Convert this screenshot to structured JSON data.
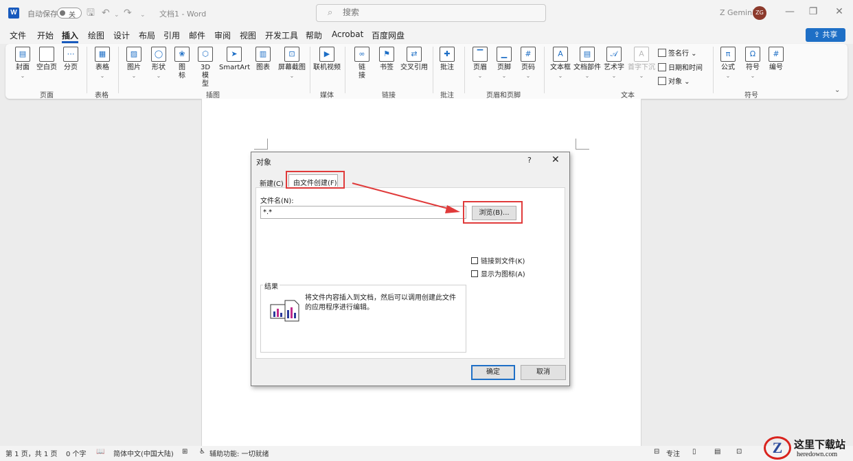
{
  "titlebar": {
    "autosave_label": "自动保存",
    "autosave_state": "关",
    "doc_title": "文档1  -  Word",
    "search_placeholder": "搜索",
    "user_name": "Z Gemini",
    "user_initials": "ZG"
  },
  "menu": {
    "tabs": [
      "文件",
      "开始",
      "插入",
      "绘图",
      "设计",
      "布局",
      "引用",
      "邮件",
      "审阅",
      "视图",
      "开发工具",
      "帮助",
      "Acrobat",
      "百度网盘"
    ],
    "active_tab": "插入",
    "share_label": "共享"
  },
  "ribbon": {
    "buttons": {
      "cover": "封面",
      "blank_page": "空白页",
      "page_break": "分页",
      "table": "表格",
      "picture": "图片",
      "shapes": "形状",
      "icons": "图\n标",
      "model3d": "3D 模\n型",
      "smartart": "SmartArt",
      "chart": "图表",
      "screenshot": "屏幕截图",
      "online_video": "联机视频",
      "link": "链\n接",
      "bookmark": "书签",
      "cross_ref": "交叉引用",
      "comment": "批注",
      "header": "页眉",
      "footer": "页脚",
      "page_number": "页码",
      "textbox": "文本框",
      "quick_parts": "文档部件",
      "wordart": "艺术字",
      "dropcap": "首字下沉",
      "signature_line": "签名行",
      "date_time": "日期和时间",
      "object": "对象",
      "equation": "公式",
      "symbol": "符号",
      "numbering": "编号"
    },
    "groups": {
      "pages": "页面",
      "tables": "表格",
      "illustrations": "插图",
      "media": "媒体",
      "links": "链接",
      "comments": "批注",
      "header_footer": "页眉和页脚",
      "text": "文本",
      "symbols": "符号"
    }
  },
  "dialog": {
    "title": "对象",
    "help": "?",
    "tab_new": "新建(C)",
    "tab_from_file": "由文件创建(F)",
    "filename_label": "文件名(N):",
    "filename_value": "*.*",
    "browse_label": "浏览(B)...",
    "link_to_file": "链接到文件(K)",
    "display_as_icon": "显示为图标(A)",
    "result_label": "结果",
    "result_text": "将文件内容插入到文档，然后可以调用创建此文件的应用程序进行编辑。",
    "ok_label": "确定",
    "cancel_label": "取消"
  },
  "statusbar": {
    "page_info": "第 1 页，共 1 页",
    "word_count": "0 个字",
    "language": "简体中文(中国大陆)",
    "accessibility": "辅助功能: 一切就绪",
    "focus": "专注"
  },
  "watermark": {
    "logo_letter": "Z",
    "site_cn": "这里下载站",
    "site_en": "heredown.com"
  },
  "colors": {
    "accent": "#185abd",
    "highlight": "#e03a3a"
  }
}
